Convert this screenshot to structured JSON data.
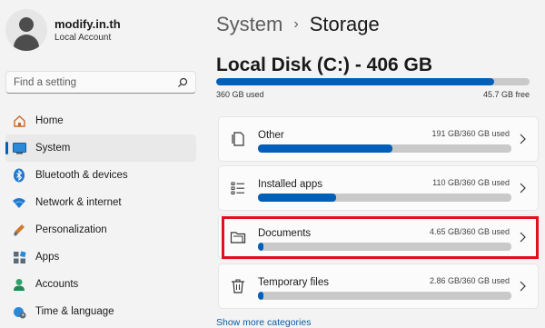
{
  "profile": {
    "name": "modify.in.th",
    "account_type": "Local Account"
  },
  "search": {
    "placeholder": "Find a setting"
  },
  "nav": [
    {
      "label": "Home",
      "icon": "home-icon"
    },
    {
      "label": "System",
      "icon": "system-icon",
      "active": true
    },
    {
      "label": "Bluetooth & devices",
      "icon": "bluetooth-icon"
    },
    {
      "label": "Network & internet",
      "icon": "wifi-icon"
    },
    {
      "label": "Personalization",
      "icon": "brush-icon"
    },
    {
      "label": "Apps",
      "icon": "apps-icon"
    },
    {
      "label": "Accounts",
      "icon": "accounts-icon"
    },
    {
      "label": "Time & language",
      "icon": "globe-clock-icon"
    }
  ],
  "breadcrumb": {
    "parent": "System",
    "separator": "›",
    "current": "Storage"
  },
  "disk": {
    "title": "Local Disk (C:) - 406 GB",
    "used_label": "360 GB used",
    "free_label": "45.7 GB free",
    "used_fraction": 0.887
  },
  "categories": [
    {
      "name": "Other",
      "usage": "191 GB/360 GB used",
      "fraction": 0.53,
      "icon": "other-files-icon"
    },
    {
      "name": "Installed apps",
      "usage": "110 GB/360 GB used",
      "fraction": 0.31,
      "icon": "installed-apps-icon"
    },
    {
      "name": "Documents",
      "usage": "4.65 GB/360 GB used",
      "fraction": 0.013,
      "icon": "folder-icon",
      "highlighted": true
    },
    {
      "name": "Temporary files",
      "usage": "2.86 GB/360 GB used",
      "fraction": 0.008,
      "icon": "trash-icon"
    }
  ],
  "show_more": "Show more categories",
  "colors": {
    "accent": "#005fb8",
    "highlight": "#e0101c"
  }
}
